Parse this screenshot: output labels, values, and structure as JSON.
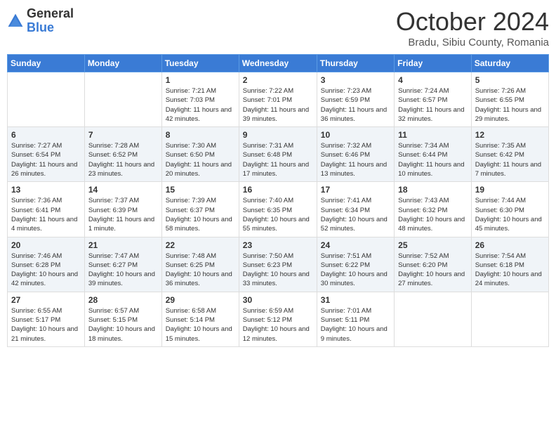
{
  "logo": {
    "general": "General",
    "blue": "Blue"
  },
  "title": "October 2024",
  "location": "Bradu, Sibiu County, Romania",
  "days_of_week": [
    "Sunday",
    "Monday",
    "Tuesday",
    "Wednesday",
    "Thursday",
    "Friday",
    "Saturday"
  ],
  "weeks": [
    [
      {
        "day": "",
        "info": ""
      },
      {
        "day": "",
        "info": ""
      },
      {
        "day": "1",
        "info": "Sunrise: 7:21 AM\nSunset: 7:03 PM\nDaylight: 11 hours and 42 minutes."
      },
      {
        "day": "2",
        "info": "Sunrise: 7:22 AM\nSunset: 7:01 PM\nDaylight: 11 hours and 39 minutes."
      },
      {
        "day": "3",
        "info": "Sunrise: 7:23 AM\nSunset: 6:59 PM\nDaylight: 11 hours and 36 minutes."
      },
      {
        "day": "4",
        "info": "Sunrise: 7:24 AM\nSunset: 6:57 PM\nDaylight: 11 hours and 32 minutes."
      },
      {
        "day": "5",
        "info": "Sunrise: 7:26 AM\nSunset: 6:55 PM\nDaylight: 11 hours and 29 minutes."
      }
    ],
    [
      {
        "day": "6",
        "info": "Sunrise: 7:27 AM\nSunset: 6:54 PM\nDaylight: 11 hours and 26 minutes."
      },
      {
        "day": "7",
        "info": "Sunrise: 7:28 AM\nSunset: 6:52 PM\nDaylight: 11 hours and 23 minutes."
      },
      {
        "day": "8",
        "info": "Sunrise: 7:30 AM\nSunset: 6:50 PM\nDaylight: 11 hours and 20 minutes."
      },
      {
        "day": "9",
        "info": "Sunrise: 7:31 AM\nSunset: 6:48 PM\nDaylight: 11 hours and 17 minutes."
      },
      {
        "day": "10",
        "info": "Sunrise: 7:32 AM\nSunset: 6:46 PM\nDaylight: 11 hours and 13 minutes."
      },
      {
        "day": "11",
        "info": "Sunrise: 7:34 AM\nSunset: 6:44 PM\nDaylight: 11 hours and 10 minutes."
      },
      {
        "day": "12",
        "info": "Sunrise: 7:35 AM\nSunset: 6:42 PM\nDaylight: 11 hours and 7 minutes."
      }
    ],
    [
      {
        "day": "13",
        "info": "Sunrise: 7:36 AM\nSunset: 6:41 PM\nDaylight: 11 hours and 4 minutes."
      },
      {
        "day": "14",
        "info": "Sunrise: 7:37 AM\nSunset: 6:39 PM\nDaylight: 11 hours and 1 minute."
      },
      {
        "day": "15",
        "info": "Sunrise: 7:39 AM\nSunset: 6:37 PM\nDaylight: 10 hours and 58 minutes."
      },
      {
        "day": "16",
        "info": "Sunrise: 7:40 AM\nSunset: 6:35 PM\nDaylight: 10 hours and 55 minutes."
      },
      {
        "day": "17",
        "info": "Sunrise: 7:41 AM\nSunset: 6:34 PM\nDaylight: 10 hours and 52 minutes."
      },
      {
        "day": "18",
        "info": "Sunrise: 7:43 AM\nSunset: 6:32 PM\nDaylight: 10 hours and 48 minutes."
      },
      {
        "day": "19",
        "info": "Sunrise: 7:44 AM\nSunset: 6:30 PM\nDaylight: 10 hours and 45 minutes."
      }
    ],
    [
      {
        "day": "20",
        "info": "Sunrise: 7:46 AM\nSunset: 6:28 PM\nDaylight: 10 hours and 42 minutes."
      },
      {
        "day": "21",
        "info": "Sunrise: 7:47 AM\nSunset: 6:27 PM\nDaylight: 10 hours and 39 minutes."
      },
      {
        "day": "22",
        "info": "Sunrise: 7:48 AM\nSunset: 6:25 PM\nDaylight: 10 hours and 36 minutes."
      },
      {
        "day": "23",
        "info": "Sunrise: 7:50 AM\nSunset: 6:23 PM\nDaylight: 10 hours and 33 minutes."
      },
      {
        "day": "24",
        "info": "Sunrise: 7:51 AM\nSunset: 6:22 PM\nDaylight: 10 hours and 30 minutes."
      },
      {
        "day": "25",
        "info": "Sunrise: 7:52 AM\nSunset: 6:20 PM\nDaylight: 10 hours and 27 minutes."
      },
      {
        "day": "26",
        "info": "Sunrise: 7:54 AM\nSunset: 6:18 PM\nDaylight: 10 hours and 24 minutes."
      }
    ],
    [
      {
        "day": "27",
        "info": "Sunrise: 6:55 AM\nSunset: 5:17 PM\nDaylight: 10 hours and 21 minutes."
      },
      {
        "day": "28",
        "info": "Sunrise: 6:57 AM\nSunset: 5:15 PM\nDaylight: 10 hours and 18 minutes."
      },
      {
        "day": "29",
        "info": "Sunrise: 6:58 AM\nSunset: 5:14 PM\nDaylight: 10 hours and 15 minutes."
      },
      {
        "day": "30",
        "info": "Sunrise: 6:59 AM\nSunset: 5:12 PM\nDaylight: 10 hours and 12 minutes."
      },
      {
        "day": "31",
        "info": "Sunrise: 7:01 AM\nSunset: 5:11 PM\nDaylight: 10 hours and 9 minutes."
      },
      {
        "day": "",
        "info": ""
      },
      {
        "day": "",
        "info": ""
      }
    ]
  ]
}
